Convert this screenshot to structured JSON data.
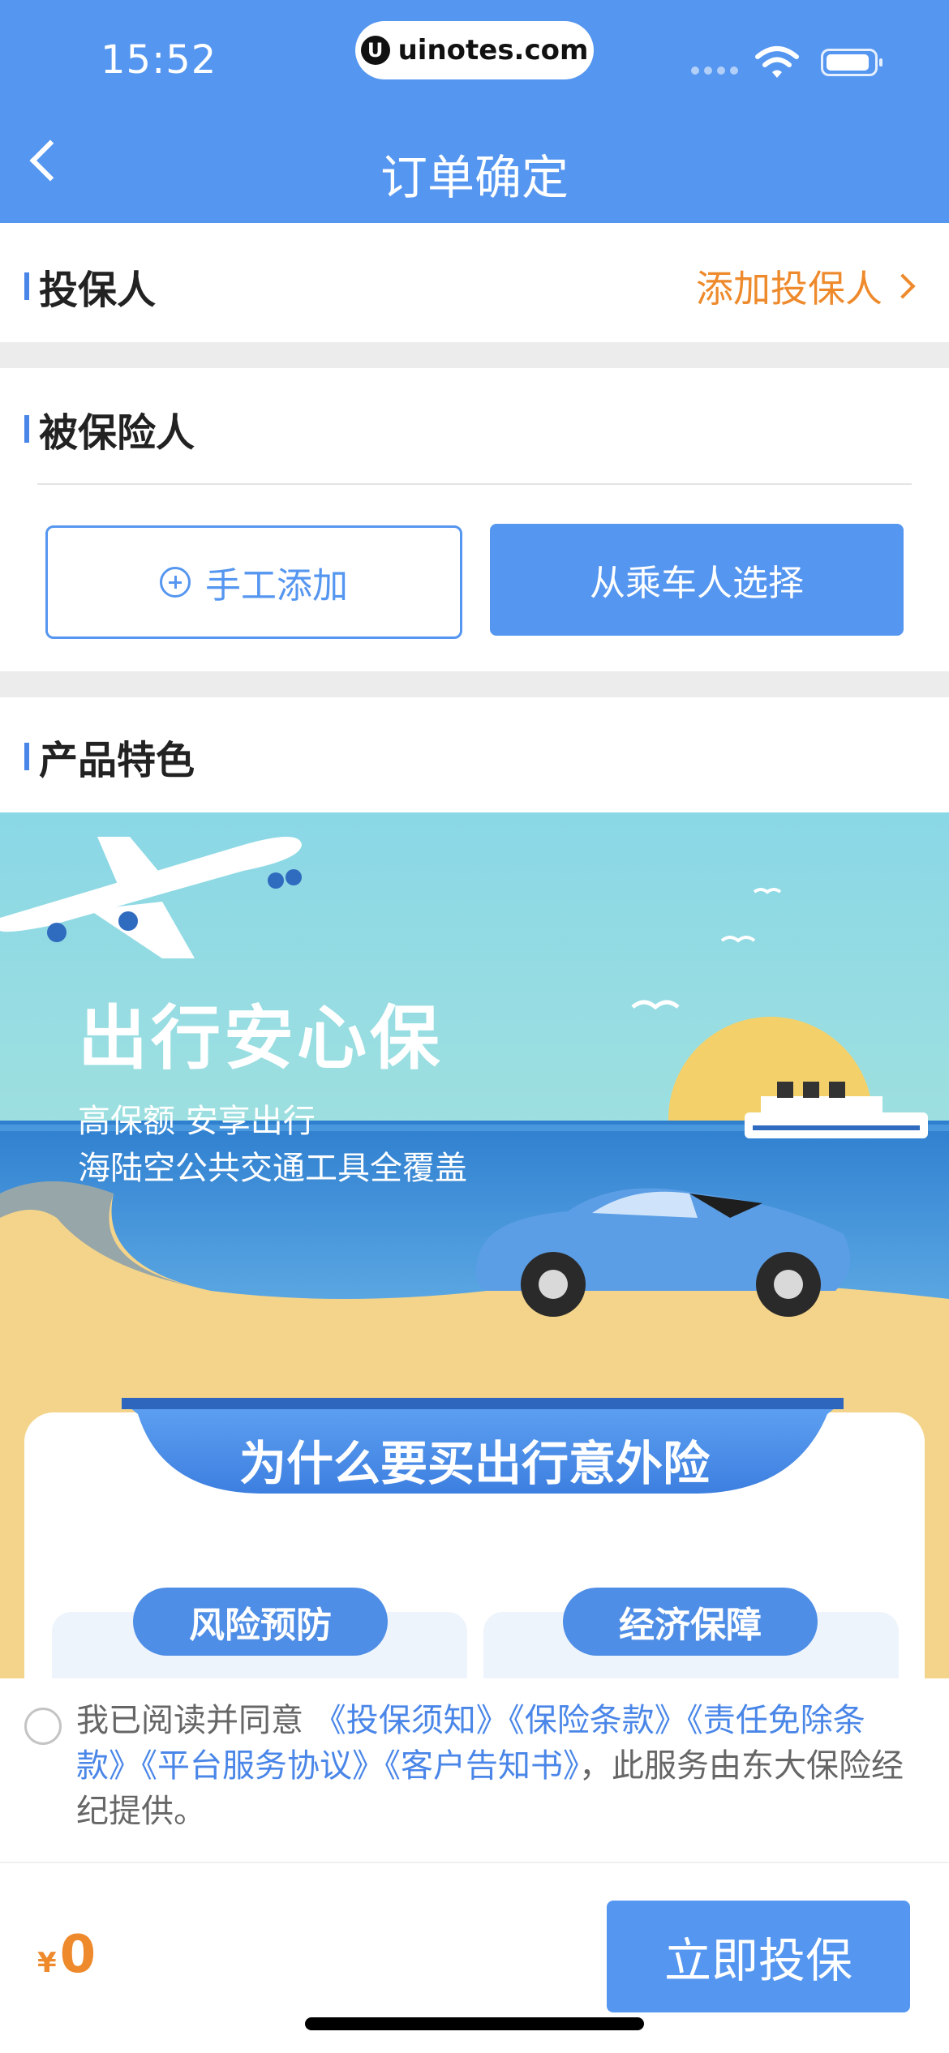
{
  "status_bar": {
    "time": "15:52",
    "url": "uinotes.com",
    "url_logo": "U"
  },
  "header": {
    "title": "订单确定"
  },
  "policy_holder": {
    "title": "投保人",
    "add_label": "添加投保人"
  },
  "insured": {
    "title": "被保险人",
    "manual_add_label": "手工添加",
    "select_passenger_label": "从乘车人选择"
  },
  "features": {
    "title": "产品特色",
    "banner": {
      "headline": "出行安心保",
      "line1": "高保额 安享出行",
      "line2": "海陆空公共交通工具全覆盖",
      "card_title": "为什么要买出行意外险",
      "tag_left": "风险预防",
      "tag_right": "经济保障"
    }
  },
  "agreement": {
    "prefix": "我已阅读并同意",
    "links": [
      "《投保须知》",
      "《保险条款》",
      "《责任免除条款》",
      "《平台服务协议》",
      "《客户告知书》"
    ],
    "suffix": "，此服务由东大保险经纪提供。"
  },
  "footer": {
    "currency": "¥",
    "price": "0",
    "buy_label": "立即投保"
  },
  "colors": {
    "primary": "#5596f0",
    "accent_orange": "#ee8a2c",
    "link_blue": "#4a86e8"
  }
}
